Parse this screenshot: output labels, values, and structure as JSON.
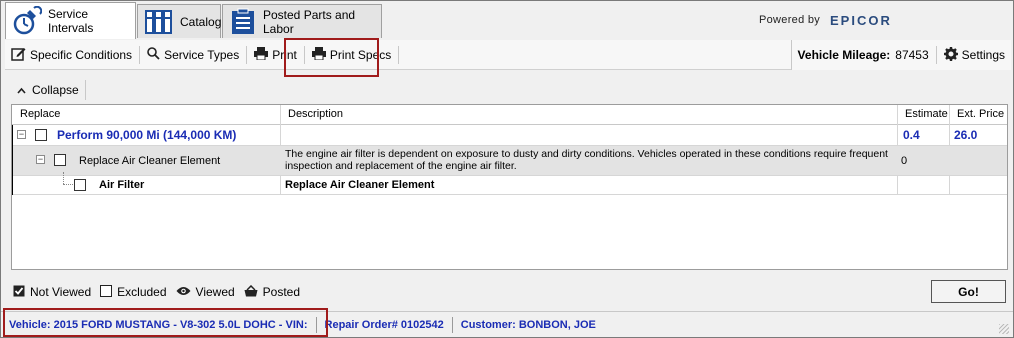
{
  "tabs": [
    {
      "label": "Service Intervals",
      "icon": "wrench-clock-icon",
      "active": true
    },
    {
      "label": "Catalog",
      "icon": "catalog-books-icon",
      "active": false
    },
    {
      "label": "Posted Parts and Labor",
      "icon": "clipboard-list-icon",
      "active": false
    }
  ],
  "branding": {
    "powered_by": "Powered by",
    "logo_text": "EPICOR"
  },
  "toolbar": {
    "specific_conditions": "Specific Conditions",
    "service_types": "Service Types",
    "print": "Print",
    "print_specs": "Print Specs",
    "vehicle_mileage_label": "Vehicle Mileage:",
    "vehicle_mileage_value": "87453",
    "settings": "Settings"
  },
  "collapse_label": "Collapse",
  "grid": {
    "columns": [
      "Replace",
      "Description",
      "Estimate",
      "Ext. Price"
    ],
    "rows": [
      {
        "name": "Perform 90,000 Mi (144,000 KM)",
        "description": "",
        "estimate": "0.4",
        "price": "26.0"
      },
      {
        "name": "Replace Air Cleaner Element",
        "description": "The engine air filter is dependent on exposure to dusty and dirty conditions. Vehicles operated in these conditions require frequent inspection and replacement of the engine air filter.",
        "estimate": "0",
        "price": ""
      },
      {
        "name": "Air Filter",
        "description": "Replace Air Cleaner Element",
        "estimate": "",
        "price": ""
      }
    ]
  },
  "legend": {
    "not_viewed": "Not Viewed",
    "excluded": "Excluded",
    "viewed": "Viewed",
    "posted": "Posted"
  },
  "go_label": "Go!",
  "status": {
    "vehicle": "Vehicle: 2015 FORD MUSTANG - V8-302  5.0L DOHC - VIN:",
    "repair_order": "Repair Order# 0102542",
    "customer": "Customer: BONBON, JOE"
  },
  "colors": {
    "accent_blue": "#1a2cb4",
    "highlight_red": "#a01b1b",
    "selected_row": "#e3e3e3"
  }
}
